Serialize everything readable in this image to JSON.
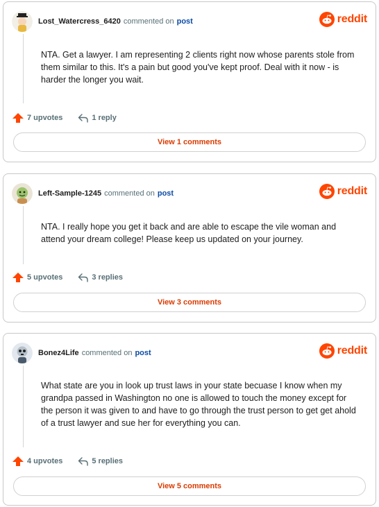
{
  "brand": {
    "name": "reddit",
    "icon": "reddit-logo-icon",
    "color": "#ff4500"
  },
  "labels": {
    "commented_on": "commented on",
    "post": "post"
  },
  "comments": [
    {
      "username": "Lost_Watercress_6420",
      "avatar": "avatar-icon",
      "body": "NTA. Get a lawyer. I am representing 2 clients right now whose parents stole from them similar to this. It's a pain but good you've kept proof. Deal with it now - is harder the longer you wait.",
      "upvotes": "7 upvotes",
      "replies": "1 reply",
      "view_label": "View 1 comments"
    },
    {
      "username": "Left-Sample-1245",
      "avatar": "avatar-icon",
      "body": "NTA. I really hope you get it back and are able to escape the vile woman and attend your dream college! Please keep us updated on your journey.",
      "upvotes": "5 upvotes",
      "replies": "3 replies",
      "view_label": "View 3 comments"
    },
    {
      "username": "Bonez4Life",
      "avatar": "avatar-icon",
      "body": "What state are you in look up trust laws in your state becuase I know when my grandpa passed in Washington no one is allowed to touch the money except for the person it was given to and have to go through the trust person to get get ahold of a trust lawyer and sue her for everything you can.",
      "upvotes": "4 upvotes",
      "replies": "5 replies",
      "view_label": "View 5 comments"
    }
  ]
}
